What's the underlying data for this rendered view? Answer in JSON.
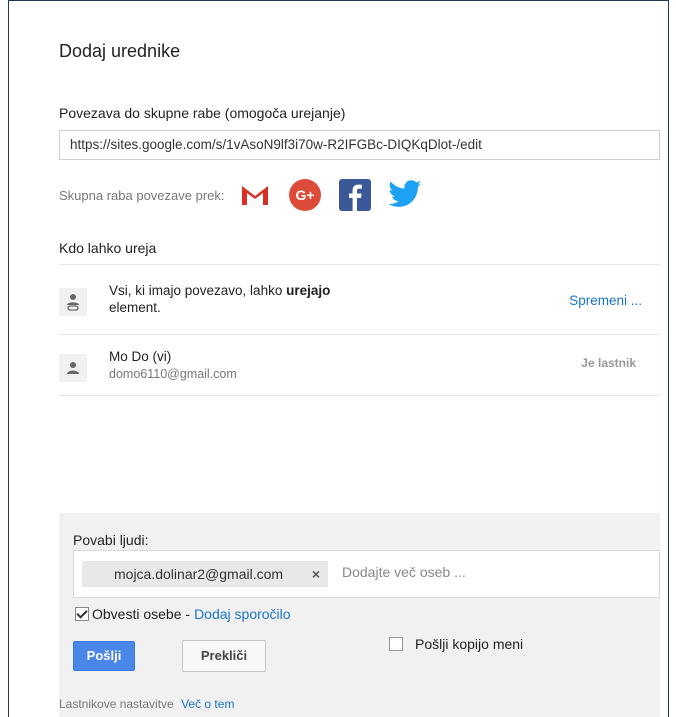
{
  "dialog": {
    "title": "Dodaj urednike",
    "link_section_label": "Povezava do skupne rabe (omogoča urejanje)",
    "share_url": "https://sites.google.com/s/1vAsoN9lf3i70w-R2IFGBc-DIQKqDlot-/edit",
    "share_via_label": "Skupna raba povezave prek:",
    "who_can_edit_label": "Kdo lahko ureja"
  },
  "access": {
    "link_text_prefix": "Vsi, ki imajo povezavo, lahko ",
    "link_text_bold": "urejajo",
    "link_text_suffix": "element.",
    "change_link": "Spremeni ..."
  },
  "owner": {
    "name": "Mo Do (vi)",
    "email": "domo6110@gmail.com",
    "role": "Je lastnik"
  },
  "invite": {
    "label": "Povabi ljudi:",
    "chip_email": "mojca.dolinar2@gmail.com",
    "chip_remove": "×",
    "placeholder": "Dodajte več oseb ...",
    "notify_label": "Obvesti osebe - ",
    "add_message_link": "Dodaj sporočilo",
    "send_button": "Pošlji",
    "cancel_button": "Prekliči",
    "copy_me_label": "Pošlji kopijo meni"
  },
  "footer": {
    "settings_label": "Lastnikove nastavitve",
    "learn_more_link": "Več o tem"
  },
  "colors": {
    "gmail_red": "#d93025",
    "gplus_red": "#dd4b39",
    "facebook_blue": "#3b5998",
    "twitter_blue": "#1da1f2",
    "link_blue": "#1a73c8",
    "primary_button": "#4a86e8"
  }
}
